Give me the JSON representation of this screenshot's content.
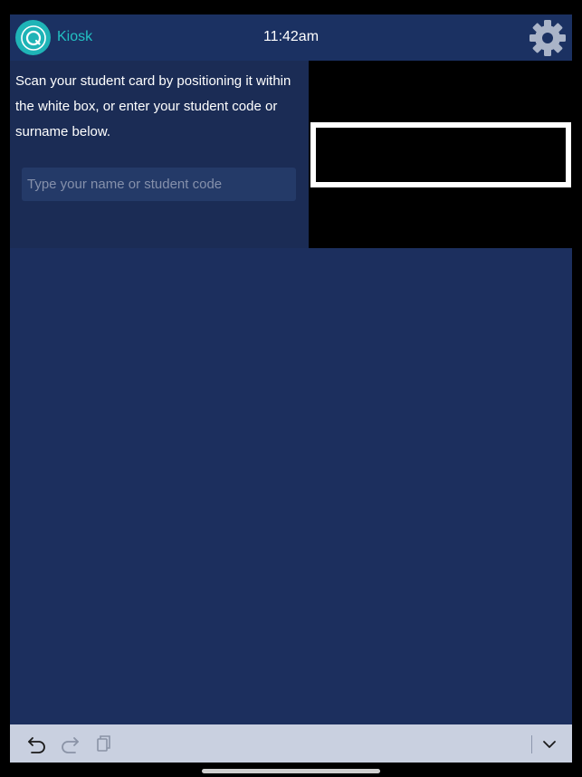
{
  "header": {
    "app_name": "Kiosk",
    "time": "11:42am",
    "logo_icon": "kiosk-logo-icon",
    "settings_icon": "gear-icon"
  },
  "scan": {
    "instructions": "Scan your student card by positioning it within the white box, or enter your student code or surname below.",
    "input_placeholder": "Type your name or student code",
    "input_value": ""
  },
  "toolbar": {
    "undo_icon": "undo-icon",
    "redo_icon": "redo-icon",
    "paste_icon": "clipboard-icon",
    "dismiss_icon": "chevron-down-icon"
  },
  "colors": {
    "accent": "#22c1c3",
    "header_bg": "#1b3162",
    "panel_bg": "#1b2c55",
    "content_bg": "#1c2f5e",
    "toolbar_bg": "#c9d0e0"
  }
}
